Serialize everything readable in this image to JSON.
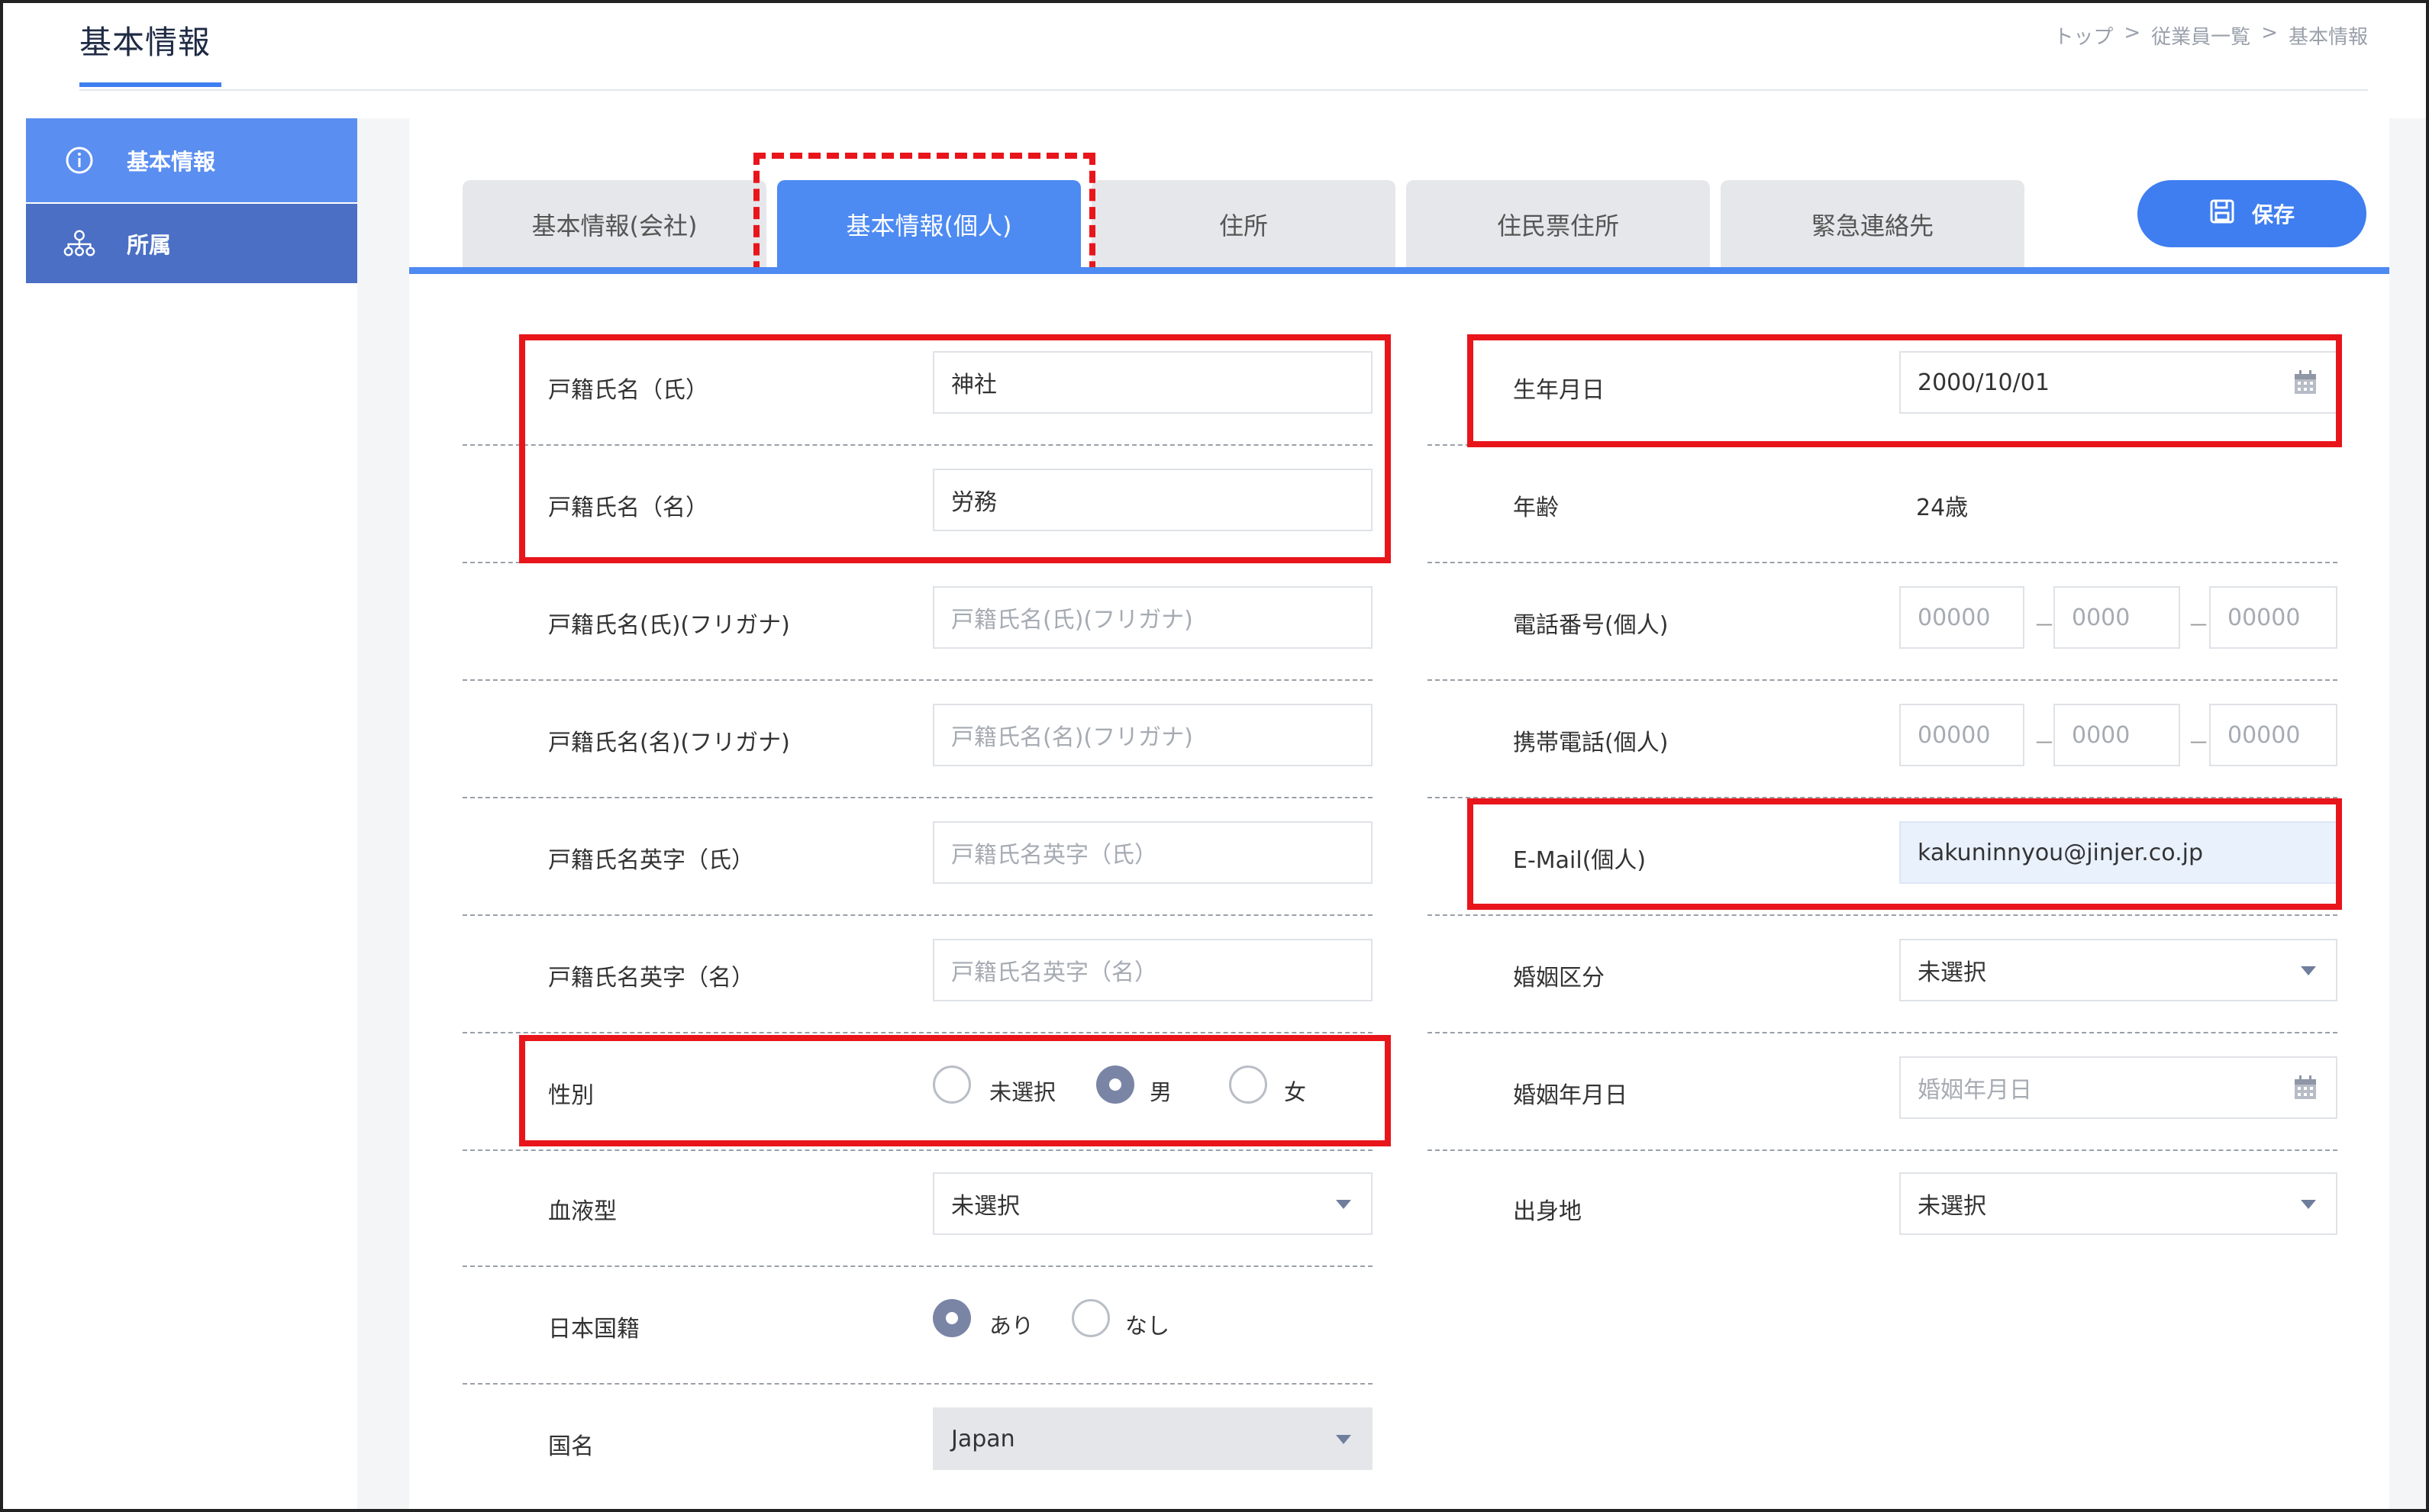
{
  "header": {
    "title": "基本情報",
    "breadcrumb": [
      "トップ",
      ">",
      "従業員一覧",
      ">",
      "基本情報"
    ]
  },
  "sidebar": {
    "items": [
      {
        "label": "基本情報",
        "icon": "info-icon",
        "active": true
      },
      {
        "label": "所属",
        "icon": "org-chart-icon",
        "active": false
      }
    ]
  },
  "tabs": [
    {
      "label": "基本情報(会社)",
      "active": false
    },
    {
      "label": "基本情報(個人)",
      "active": true
    },
    {
      "label": "住所",
      "active": false
    },
    {
      "label": "住民票住所",
      "active": false
    },
    {
      "label": "緊急連絡先",
      "active": false
    }
  ],
  "toolbar": {
    "save_label": "保存",
    "save_icon": "floppy-disk-icon"
  },
  "left_fields": {
    "family_name": {
      "label": "戸籍氏名（氏）",
      "value": "神社"
    },
    "given_name": {
      "label": "戸籍氏名（名）",
      "value": "労務"
    },
    "family_kana": {
      "label": "戸籍氏名(氏)(フリガナ)",
      "placeholder": "戸籍氏名(氏)(フリガナ)"
    },
    "given_kana": {
      "label": "戸籍氏名(名)(フリガナ)",
      "placeholder": "戸籍氏名(名)(フリガナ)"
    },
    "family_en": {
      "label": "戸籍氏名英字（氏）",
      "placeholder": "戸籍氏名英字（氏）"
    },
    "given_en": {
      "label": "戸籍氏名英字（名）",
      "placeholder": "戸籍氏名英字（名）"
    },
    "gender": {
      "label": "性別",
      "options": [
        "未選択",
        "男",
        "女"
      ],
      "selected": "男"
    },
    "blood_type": {
      "label": "血液型",
      "value": "未選択"
    },
    "japanese_nationality": {
      "label": "日本国籍",
      "options": [
        "あり",
        "なし"
      ],
      "selected": "あり"
    },
    "country": {
      "label": "国名",
      "value": "Japan"
    }
  },
  "right_fields": {
    "birthday": {
      "label": "生年月日",
      "value": "2000/10/01"
    },
    "age": {
      "label": "年齢",
      "value": "24歳"
    },
    "phone": {
      "label": "電話番号(個人)",
      "placeholders": [
        "00000",
        "0000",
        "00000"
      ],
      "separator": "－"
    },
    "mobile": {
      "label": "携帯電話(個人)",
      "placeholders": [
        "00000",
        "0000",
        "00000"
      ],
      "separator": "－"
    },
    "email": {
      "label": "E-Mail(個人)",
      "value": "kakuninnyou@jinjer.co.jp"
    },
    "marital_status": {
      "label": "婚姻区分",
      "value": "未選択"
    },
    "marriage_date": {
      "label": "婚姻年月日",
      "placeholder": "婚姻年月日"
    },
    "birthplace": {
      "label": "出身地",
      "value": "未選択"
    }
  },
  "colors": {
    "accent": "#4d8af2",
    "highlight": "#e8151b",
    "sidebar_active": "#5a8ef0",
    "sidebar": "#4a6fc4"
  }
}
